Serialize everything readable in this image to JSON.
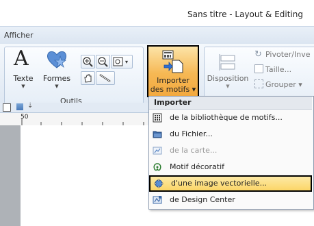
{
  "window": {
    "title": "Sans titre - Layout & Editing"
  },
  "menubar": {
    "tab_label": "Afficher"
  },
  "ribbon": {
    "tools_group": {
      "label": "Outils",
      "text_label": "Texte",
      "shapes_label": "Formes"
    },
    "import_button": {
      "label_line1": "Importer",
      "label_line2": "des motifs ▾"
    },
    "layout": {
      "disposition_label": "Disposition",
      "rotate_label": "Pivoter/Inve",
      "size_label": "Taille...",
      "group_label": "Grouper ▾"
    }
  },
  "ruler": {
    "first_number": "50"
  },
  "dropdown": {
    "header": "Importer",
    "items": [
      {
        "label": "de la bibliothèque de motifs...",
        "icon": "library-icon",
        "enabled": true
      },
      {
        "label": "du Fichier...",
        "icon": "folder-icon",
        "enabled": true
      },
      {
        "label": "de la carte...",
        "icon": "card-icon",
        "enabled": false
      },
      {
        "label": "Motif décoratif",
        "icon": "decorative-pattern-icon",
        "enabled": true
      },
      {
        "label": "d'une image vectorielle...",
        "icon": "vector-image-icon",
        "enabled": true,
        "highlighted": true
      },
      {
        "label": "de Design Center",
        "icon": "design-center-icon",
        "enabled": true
      }
    ]
  },
  "colors": {
    "highlight": "#fbd567",
    "import_button": "#f6b854",
    "ribbon": "#dfe8f3"
  }
}
